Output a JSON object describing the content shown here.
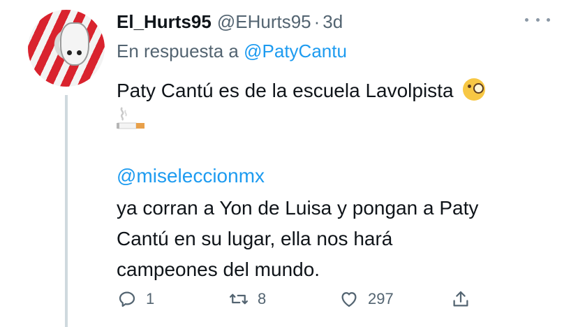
{
  "tweet": {
    "display_name": "El_Hurts95",
    "handle": "@EHurts95",
    "separator": "·",
    "time": "3d",
    "reply_prefix": "En respuesta a",
    "reply_to": "@PatyCantu",
    "body_line1": "Paty Cantú es de la escuela Lavolpista",
    "mention": "@miseleccionmx",
    "body_line2": " ya corran a Yon de Luisa y pongan a Paty",
    "body_line3": "Cantú en su lugar, ella nos hará",
    "body_line4": "campeones del mundo.",
    "emojis": [
      "face-with-monocle-emoji",
      "cigarette-emoji"
    ]
  },
  "actions": {
    "reply_count": "1",
    "retweet_count": "8",
    "like_count": "297"
  },
  "colors": {
    "accent": "#1d9bf0",
    "secondary_text": "#536471",
    "primary_text": "#0f1419",
    "thread_line": "#cfd9de"
  }
}
